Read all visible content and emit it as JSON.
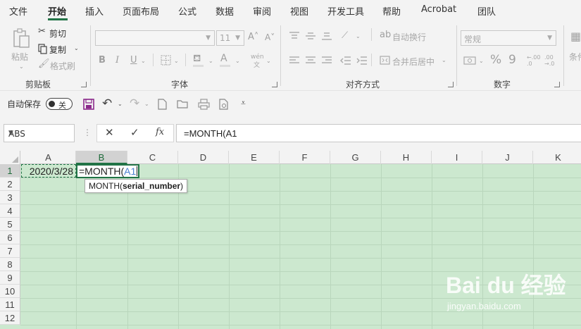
{
  "ribbon_tabs": [
    "文件",
    "开始",
    "插入",
    "页面布局",
    "公式",
    "数据",
    "审阅",
    "视图",
    "开发工具",
    "帮助",
    "Acrobat",
    "团队"
  ],
  "active_tab": "开始",
  "clipboard": {
    "paste_label": "粘贴",
    "cut_label": "剪切",
    "copy_label": "复制",
    "format_painter_label": "格式刷",
    "group_label": "剪贴板"
  },
  "font": {
    "font_name": "",
    "font_size": "11",
    "bold": "B",
    "italic": "I",
    "underline": "U",
    "phonetic": "wén",
    "group_label": "字体"
  },
  "alignment": {
    "wrap_text_label": "自动换行",
    "merge_center_label": "合并后居中",
    "group_label": "对齐方式"
  },
  "number": {
    "format_value": "常规",
    "percent": "%",
    "comma": "9",
    "increase_decimal": "←.00 .0",
    "decrease_decimal": ".00 →.0",
    "group_label": "数字"
  },
  "styles": {
    "conditional_label": "条件"
  },
  "quick_access": {
    "autosave_label": "自动保存",
    "autosave_state": "关"
  },
  "formula_bar": {
    "name_box": "ABS",
    "fx_label": "fx",
    "formula": "=MONTH(A1"
  },
  "columns": [
    "A",
    "B",
    "C",
    "D",
    "E",
    "F",
    "G",
    "H",
    "I",
    "J",
    "K"
  ],
  "rows": [
    "1",
    "2",
    "3",
    "4",
    "5",
    "6",
    "7",
    "8",
    "9",
    "10",
    "11",
    "12"
  ],
  "cells": {
    "A1": "2020/3/28",
    "B1_prefix": "=MONTH(",
    "B1_ref": "A1"
  },
  "tooltip": {
    "func": "MONTH(",
    "arg": "serial_number",
    "close": ")"
  },
  "watermark": {
    "brand": "Bai du 经验",
    "url": "jingyan.baidu.com"
  },
  "colors": {
    "accent_green": "#217346",
    "grid_bg": "#cce8cf",
    "ref_blue": "#4a7fd0"
  }
}
